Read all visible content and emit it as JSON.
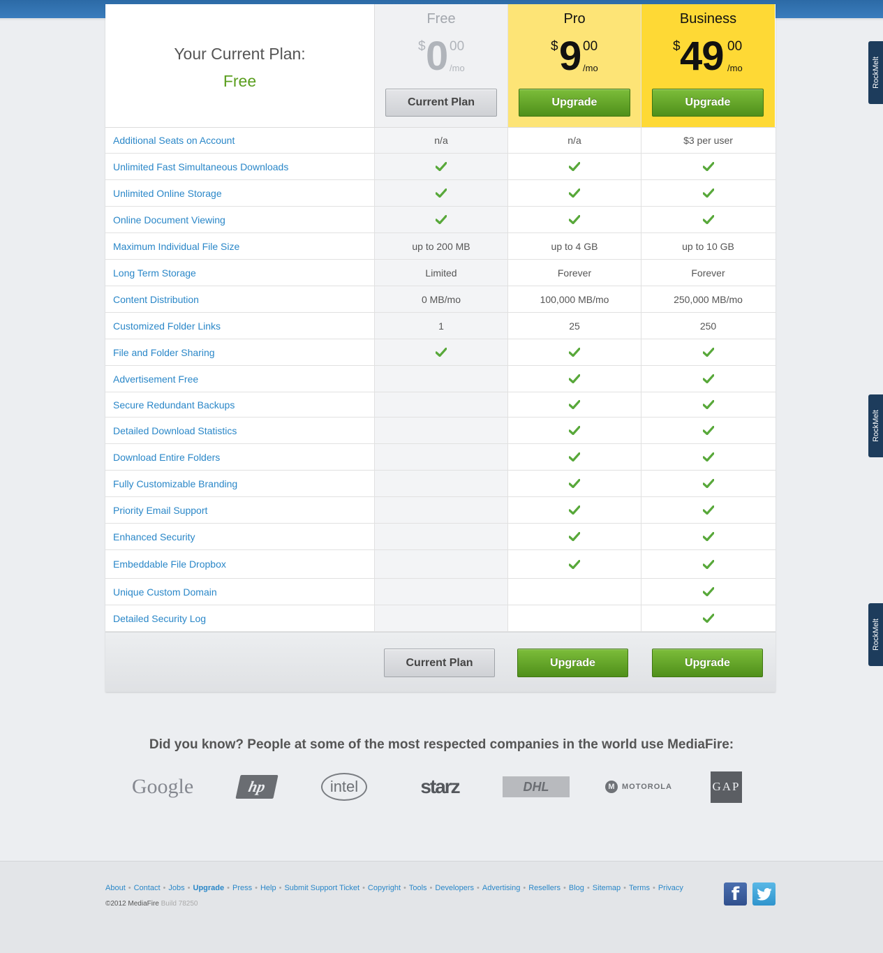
{
  "header": {
    "current_plan_label": "Your Current Plan:",
    "current_plan_value": "Free"
  },
  "plans": [
    {
      "name": "Free",
      "currency": "$",
      "amount": "0",
      "cents": "00",
      "period": "/mo",
      "button": "Current Plan",
      "button_style": "grey"
    },
    {
      "name": "Pro",
      "currency": "$",
      "amount": "9",
      "cents": "00",
      "period": "/mo",
      "button": "Upgrade",
      "button_style": "green"
    },
    {
      "name": "Business",
      "currency": "$",
      "amount": "49",
      "cents": "00",
      "period": "/mo",
      "button": "Upgrade",
      "button_style": "green"
    }
  ],
  "features": [
    {
      "name": "Additional Seats on Account",
      "values": [
        "n/a",
        "n/a",
        "$3 per user"
      ]
    },
    {
      "name": "Unlimited Fast Simultaneous Downloads",
      "values": [
        "check",
        "check",
        "check"
      ]
    },
    {
      "name": "Unlimited Online Storage",
      "values": [
        "check",
        "check",
        "check"
      ]
    },
    {
      "name": "Online Document Viewing",
      "values": [
        "check",
        "check",
        "check"
      ]
    },
    {
      "name": "Maximum Individual File Size",
      "values": [
        "up to 200 MB",
        "up to 4 GB",
        "up to 10 GB"
      ]
    },
    {
      "name": "Long Term Storage",
      "values": [
        "Limited",
        "Forever",
        "Forever"
      ]
    },
    {
      "name": "Content Distribution",
      "values": [
        "0 MB/mo",
        "100,000 MB/mo",
        "250,000 MB/mo"
      ]
    },
    {
      "name": "Customized Folder Links",
      "values": [
        "1",
        "25",
        "250"
      ]
    },
    {
      "name": "File and Folder Sharing",
      "values": [
        "check",
        "check",
        "check"
      ]
    },
    {
      "name": "Advertisement Free",
      "values": [
        "",
        "check",
        "check"
      ]
    },
    {
      "name": "Secure Redundant Backups",
      "values": [
        "",
        "check",
        "check"
      ]
    },
    {
      "name": "Detailed Download Statistics",
      "values": [
        "",
        "check",
        "check"
      ]
    },
    {
      "name": "Download Entire Folders",
      "values": [
        "",
        "check",
        "check"
      ]
    },
    {
      "name": "Fully Customizable Branding",
      "values": [
        "",
        "check",
        "check"
      ]
    },
    {
      "name": "Priority Email Support",
      "values": [
        "",
        "check",
        "check"
      ]
    },
    {
      "name": "Enhanced Security",
      "values": [
        "",
        "check",
        "check"
      ]
    },
    {
      "name": "Embeddable File Dropbox",
      "values": [
        "",
        "check",
        "check"
      ]
    },
    {
      "name": "Unique Custom Domain",
      "values": [
        "",
        "",
        "check"
      ]
    },
    {
      "name": "Detailed Security Log",
      "values": [
        "",
        "",
        "check"
      ]
    }
  ],
  "footer_buttons": [
    "Current Plan",
    "Upgrade",
    "Upgrade"
  ],
  "companies": {
    "heading": "Did you know? People at some of the most respected companies in the world use MediaFire:",
    "logos": [
      "Google",
      "hp",
      "intel",
      "starz",
      "DHL",
      "MOTOROLA",
      "GAP"
    ]
  },
  "footer": {
    "links": [
      "About",
      "Contact",
      "Jobs",
      "Upgrade",
      "Press",
      "Help",
      "Submit Support Ticket",
      "Copyright",
      "Tools",
      "Developers",
      "Advertising",
      "Resellers",
      "Blog",
      "Sitemap",
      "Terms",
      "Privacy"
    ],
    "bold_link": "Upgrade",
    "copyright": "©2012 MediaFire",
    "build": "Build 78250",
    "social_facebook": "f"
  },
  "side_tabs": [
    "RockMelt",
    "RockMelt",
    "RockMelt"
  ],
  "colors": {
    "accent_link": "#2a87c8",
    "green": "#5a9e1e",
    "pro_yellow": "#fde476",
    "business_yellow": "#fed935",
    "topbar": "#2c6aa6"
  }
}
